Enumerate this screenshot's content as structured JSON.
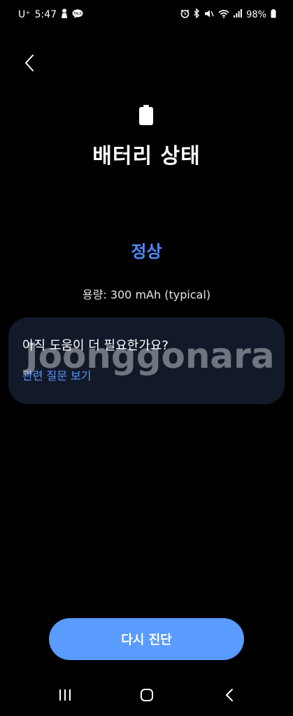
{
  "status_bar": {
    "carrier": "U⁺",
    "time": "5:47",
    "battery_percent": "98%",
    "icons_left": [
      "person-icon",
      "talk-icon"
    ],
    "icons_right": [
      "alarm-icon",
      "bluetooth-icon",
      "mute-icon",
      "wifi-icon",
      "signal-icon",
      "battery-icon"
    ]
  },
  "header": {
    "back_icon": "chevron-left-icon"
  },
  "hero": {
    "icon": "battery-icon",
    "title": "배터리 상태"
  },
  "battery": {
    "status": "정상",
    "capacity": "용량: 300 mAh (typical)"
  },
  "help_card": {
    "title": "아직 도움이 더 필요한가요?",
    "link": "관련 질문 보기"
  },
  "watermark": "Joonggonara",
  "actions": {
    "rediagnose_label": "다시 진단"
  },
  "nav_bar": {
    "icons": [
      "recents-icon",
      "home-icon",
      "back-icon"
    ]
  },
  "colors": {
    "accent": "#4f8cff",
    "button": "#5a9bff",
    "card": "#121a2a",
    "background": "#000000"
  }
}
